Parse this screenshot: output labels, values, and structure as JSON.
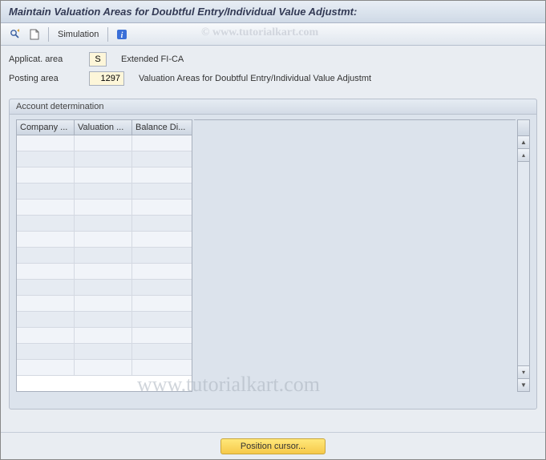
{
  "title": "Maintain Valuation Areas for Doubtful Entry/Individual Value Adjustmt:",
  "toolbar": {
    "simulation_label": "Simulation"
  },
  "fields": {
    "applicat_area": {
      "label": "Applicat. area",
      "value": "S",
      "description": "Extended FI-CA"
    },
    "posting_area": {
      "label": "Posting area",
      "value": "1297",
      "description": "Valuation Areas for Doubtful Entry/Individual Value Adjustmt"
    }
  },
  "group": {
    "title": "Account determination",
    "columns": [
      "Company ...",
      "Valuation ...",
      "Balance Di..."
    ],
    "rows": [
      [
        "",
        "",
        ""
      ],
      [
        "",
        "",
        ""
      ],
      [
        "",
        "",
        ""
      ],
      [
        "",
        "",
        ""
      ],
      [
        "",
        "",
        ""
      ],
      [
        "",
        "",
        ""
      ],
      [
        "",
        "",
        ""
      ],
      [
        "",
        "",
        ""
      ],
      [
        "",
        "",
        ""
      ],
      [
        "",
        "",
        ""
      ],
      [
        "",
        "",
        ""
      ],
      [
        "",
        "",
        ""
      ],
      [
        "",
        "",
        ""
      ],
      [
        "",
        "",
        ""
      ],
      [
        "",
        "",
        ""
      ]
    ]
  },
  "buttons": {
    "position_cursor": "Position cursor..."
  },
  "watermark": {
    "logo": "© www.tutorialkart.com",
    "url": "www.tutorialkart.com"
  }
}
